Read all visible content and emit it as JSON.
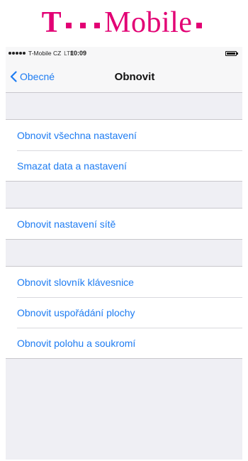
{
  "brand": {
    "t": "T",
    "name": "Mobile",
    "color": "#e20074"
  },
  "status_bar": {
    "carrier": "T-Mobile CZ",
    "network": "LTE",
    "time": "10:09"
  },
  "nav": {
    "back_label": "Obecné",
    "title": "Obnovit"
  },
  "groups": [
    {
      "items": [
        {
          "label": "Obnovit všechna nastavení"
        },
        {
          "label": "Smazat data a nastavení"
        }
      ]
    },
    {
      "items": [
        {
          "label": "Obnovit nastavení sítě"
        }
      ]
    },
    {
      "items": [
        {
          "label": "Obnovit slovník klávesnice"
        },
        {
          "label": "Obnovit uspořádání plochy"
        },
        {
          "label": "Obnovit polohu a soukromí"
        }
      ]
    }
  ],
  "colors": {
    "accent": "#1e7cf2",
    "background": "#efeff4"
  }
}
